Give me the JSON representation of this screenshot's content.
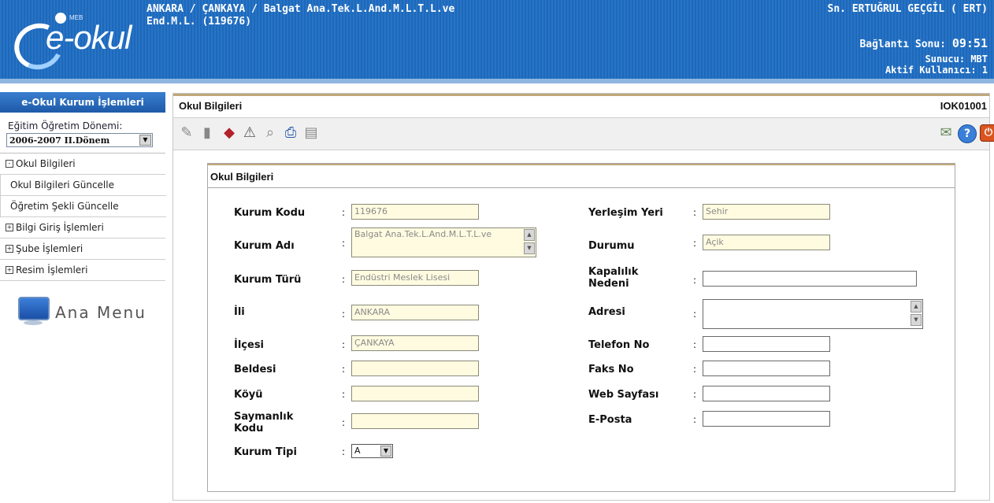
{
  "header": {
    "logo_small": "MEB",
    "logo_text": "e-okul",
    "school_line1": "ANKARA / ÇANKAYA / Balgat Ana.Tek.L.And.M.L.T.L.ve",
    "school_line2": "End.M.L. (119676)",
    "user": "Sn. ERTUĞRUL GEÇGİL ( ERT)",
    "connection_label": "Bağlantı Sonu:",
    "connection_time": "09:51",
    "server": "Sunucu: MBT",
    "active_users": "Aktif Kullanıcı: 1"
  },
  "sidebar": {
    "title": "e-Okul Kurum İşlemleri",
    "term_label": "Eğitim Öğretim Dönemi:",
    "term_value": "2006-2007 II.Dönem",
    "items": [
      {
        "label": "Okul Bilgileri",
        "sub": false,
        "expanded": true
      },
      {
        "label": "Okul Bilgileri Güncelle",
        "sub": true
      },
      {
        "label": "Öğretim Şekli Güncelle",
        "sub": true
      },
      {
        "label": "Bilgi Giriş İşlemleri",
        "sub": false,
        "expanded": false
      },
      {
        "label": "Şube İşlemleri",
        "sub": false,
        "expanded": false
      },
      {
        "label": "Resim İşlemleri",
        "sub": false,
        "expanded": false
      }
    ],
    "ana_menu": "Ana Menu"
  },
  "main": {
    "title": "Okul Bilgileri",
    "code": "IOK01001",
    "toolbar_icons": [
      "edit-icon",
      "delete-icon",
      "clear-icon",
      "warning-icon",
      "search-icon",
      "print-icon",
      "export-icon",
      "message-icon",
      "help-icon",
      "exit-icon"
    ]
  },
  "panel": {
    "title": "Okul Bilgileri",
    "colon": ":",
    "left": {
      "kurum_kodu": {
        "label": "Kurum Kodu",
        "value": "119676"
      },
      "kurum_adi": {
        "label": "Kurum Adı",
        "value": "Balgat Ana.Tek.L.And.M.L.T.L.ve"
      },
      "kurum_turu": {
        "label": "Kurum Türü",
        "value": "Endüstri Meslek Lisesi"
      },
      "ili": {
        "label": "İli",
        "value": "ANKARA"
      },
      "ilcesi": {
        "label": "İlçesi",
        "value": "ÇANKAYA"
      },
      "beldesi": {
        "label": "Beldesi",
        "value": ""
      },
      "koyu": {
        "label": "Köyü",
        "value": ""
      },
      "saymanlik": {
        "label": "Saymanlık Kodu",
        "value": ""
      },
      "kurum_tipi": {
        "label": "Kurum Tipi",
        "value": "A"
      }
    },
    "right": {
      "yerlesim": {
        "label": "Yerleşim Yeri",
        "value": "Sehir"
      },
      "durumu": {
        "label": "Durumu",
        "value": "Açik"
      },
      "kapalilik": {
        "label": "Kapalılık Nedeni",
        "value": ""
      },
      "adresi": {
        "label": "Adresi",
        "value": ""
      },
      "telefon": {
        "label": "Telefon No",
        "value": ""
      },
      "faks": {
        "label": "Faks No",
        "value": ""
      },
      "web": {
        "label": "Web Sayfası",
        "value": ""
      },
      "eposta": {
        "label": "E-Posta",
        "value": ""
      }
    }
  }
}
